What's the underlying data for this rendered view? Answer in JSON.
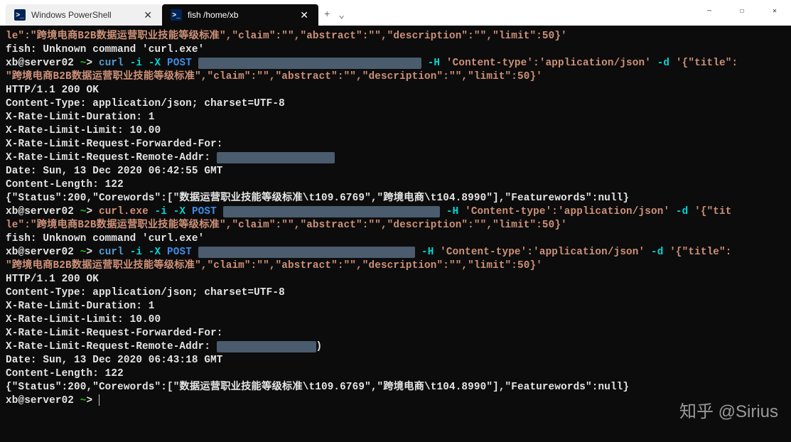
{
  "title_bar": {
    "tabs": [
      {
        "label": "Windows PowerShell",
        "icon": ">_",
        "active": false
      },
      {
        "label": "fish  /home/xb",
        "icon": ">_",
        "active": true
      }
    ],
    "new_tab": "+",
    "dropdown": "⌄"
  },
  "window_controls": {
    "minimize": "─",
    "maximize": "☐",
    "close": "✕"
  },
  "terminal": {
    "lines": [
      {
        "type": "json_frag",
        "text": "le\":\"跨境电商B2B数据运营职业技能等级标准\",\"claim\":\"\",\"abstract\":\"\",\"description\":\"\",\"limit\":50}'"
      },
      {
        "type": "err",
        "text": "fish: Unknown command 'curl.exe'"
      },
      {
        "type": "prompt_curl",
        "user": "xb@server02",
        "cmd": "curl",
        "flags1": "-i",
        "flags2": "-X",
        "method": "POST",
        "redact": "███ ███ ███ ███████/pa██████████████",
        "flagH": "-H",
        "header": "'Content-type':'application/json'",
        "flagD": "-d",
        "body": "'{\"title\":"
      },
      {
        "type": "json_cont",
        "text": "\"跨境电商B2B数据运营职业技能等级标准\",\"claim\":\"\",\"abstract\":\"\",\"description\":\"\",\"limit\":50}'"
      },
      {
        "type": "resp",
        "text": "HTTP/1.1 200 OK"
      },
      {
        "type": "resp",
        "text": "Content-Type: application/json; charset=UTF-8"
      },
      {
        "type": "resp",
        "text": "X-Rate-Limit-Duration: 1"
      },
      {
        "type": "resp",
        "text": "X-Rate-Limit-Limit: 10.00"
      },
      {
        "type": "resp",
        "text": "X-Rate-Limit-Request-Forwarded-For:"
      },
      {
        "type": "resp_redact",
        "prefix": "X-Rate-Limit-Request-Remote-Addr: ",
        "redact": "██████████ ██ █████"
      },
      {
        "type": "resp",
        "text": "Date: Sun, 13 Dec 2020 06:42:55 GMT"
      },
      {
        "type": "resp",
        "text": "Content-Length: 122"
      },
      {
        "type": "blank",
        "text": ""
      },
      {
        "type": "resp",
        "text": "{\"Status\":200,\"Corewords\":[\"数据运营职业技能等级标准\\t109.6769\",\"跨境电商\\t104.8990\"],\"Featurewords\":null}"
      },
      {
        "type": "prompt_curlexe",
        "user": "xb@server02",
        "cmd": "curl.exe",
        "flags1": "-i",
        "flags2": "-X",
        "method": "POST",
        "redact": "███ ███ ███ ██:████/pa█████████████",
        "flagH": "-H",
        "header": "'Content-type':'application/json'",
        "flagD": "-d",
        "body": "'{\"tit"
      },
      {
        "type": "json_frag",
        "text": "le\":\"跨境电商B2B数据运营职业技能等级标准\",\"claim\":\"\",\"abstract\":\"\",\"description\":\"\",\"limit\":50}'"
      },
      {
        "type": "err",
        "text": "fish: Unknown command 'curl.exe'"
      },
      {
        "type": "prompt_curl",
        "user": "xb@server02",
        "cmd": "curl",
        "flags1": "-i",
        "flags2": "-X",
        "method": "POST",
        "redact": "███ ███ ███ ██:8███/pa█████████████",
        "flagH": "-H",
        "header": "'Content-type':'application/json'",
        "flagD": "-d",
        "body": "'{\"title\":"
      },
      {
        "type": "json_cont",
        "text": "\"跨境电商B2B数据运营职业技能等级标准\",\"claim\":\"\",\"abstract\":\"\",\"description\":\"\",\"limit\":50}'"
      },
      {
        "type": "resp",
        "text": "HTTP/1.1 200 OK"
      },
      {
        "type": "resp",
        "text": "Content-Type: application/json; charset=UTF-8"
      },
      {
        "type": "resp",
        "text": "X-Rate-Limit-Duration: 1"
      },
      {
        "type": "resp",
        "text": "X-Rate-Limit-Limit: 10.00"
      },
      {
        "type": "resp",
        "text": "X-Rate-Limit-Request-Forwarded-For:"
      },
      {
        "type": "resp_redact",
        "prefix": "X-Rate-Limit-Request-Remote-Addr: ",
        "redact": "████████ ██ ████",
        "suffix": ")"
      },
      {
        "type": "resp",
        "text": "Date: Sun, 13 Dec 2020 06:43:18 GMT"
      },
      {
        "type": "resp",
        "text": "Content-Length: 122"
      },
      {
        "type": "blank",
        "text": ""
      },
      {
        "type": "resp",
        "text": "{\"Status\":200,\"Corewords\":[\"数据运营职业技能等级标准\\t109.6769\",\"跨境电商\\t104.8990\"],\"Featurewords\":null}"
      },
      {
        "type": "prompt_empty",
        "user": "xb@server02"
      }
    ]
  },
  "watermark": "知乎 @Sirius",
  "colors": {
    "bg": "#0c0c0c",
    "fg": "#cccccc",
    "cyan": "#00d7d7",
    "blue": "#3b8eea",
    "orange": "#ce9178",
    "green": "#16c60c"
  }
}
